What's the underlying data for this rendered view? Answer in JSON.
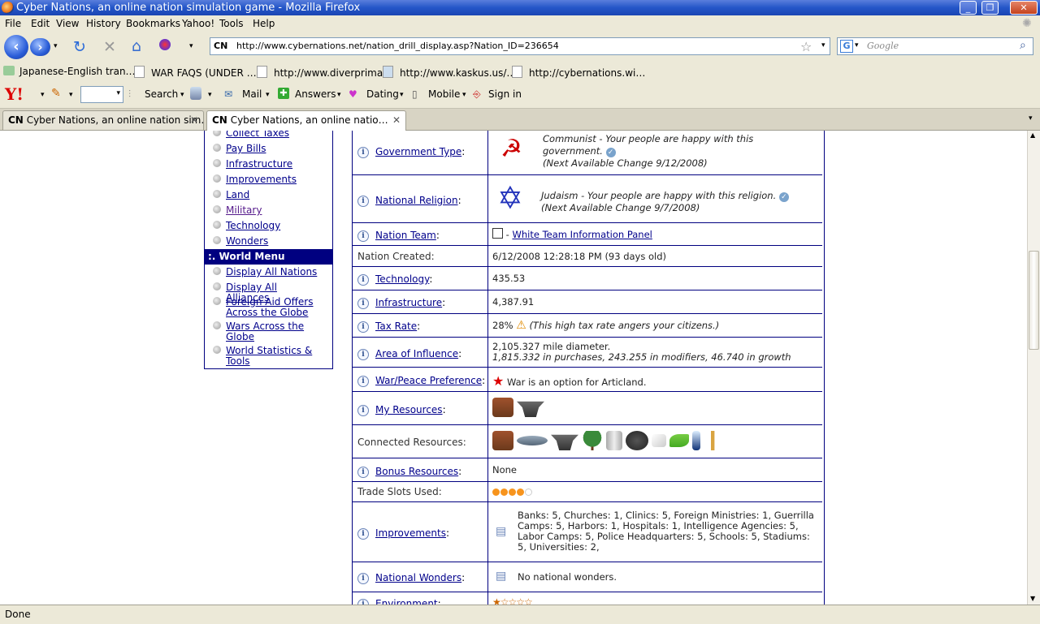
{
  "window": {
    "title": "Cyber Nations, an online nation simulation game - Mozilla Firefox"
  },
  "menu": [
    "File",
    "Edit",
    "View",
    "History",
    "Bookmarks",
    "Yahoo!",
    "Tools",
    "Help"
  ],
  "nav": {
    "site_badge": "CN",
    "url": "http://www.cybernations.net/nation_drill_display.asp?Nation_ID=236654",
    "search_placeholder": "Google"
  },
  "bookmarks": [
    "Japanese-English tran…",
    "WAR FAQS (UNDER …",
    "http://www.diverprima…",
    "http://www.kaskus.us/…",
    "http://cybernations.wi…"
  ],
  "yahoo_toolbar": {
    "logo": "Y!",
    "search": "Search",
    "mail": "Mail",
    "answers": "Answers",
    "dating": "Dating",
    "mobile": "Mobile",
    "signin": "Sign in"
  },
  "tabs": [
    {
      "badge": "CN",
      "label": "Cyber Nations, an online nation sim…"
    },
    {
      "badge": "CN",
      "label": "Cyber Nations, an online natio…"
    }
  ],
  "left_menu": {
    "nation_items": [
      "Collect Taxes",
      "Pay Bills",
      "Infrastructure",
      "Improvements",
      "Land",
      "Military",
      "Technology",
      "Wonders"
    ],
    "world_header": ":. World Menu",
    "world_items": [
      "Display All Nations",
      "Display All Alliances",
      "Foreign Aid Offers Across the Globe",
      "Wars Across the Globe",
      "World Statistics & Tools"
    ]
  },
  "stats": {
    "gov_label": "Government Type",
    "gov_line1": "Communist - Your people are happy with this",
    "gov_line2": "government.",
    "gov_line3": "(Next Available Change 9/12/2008)",
    "rel_label": "National Religion",
    "rel_line1": "Judaism - Your people are happy with this religion.",
    "rel_line2": "(Next Available Change 9/7/2008)",
    "team_label": "Nation Team",
    "team_link": "White Team Information Panel",
    "created_label": "Nation Created:",
    "created_value": "6/12/2008 12:28:18 PM (93 days old)",
    "tech_label": "Technology",
    "tech_value": "435.53",
    "infra_label": "Infrastructure",
    "infra_value": "4,387.91",
    "tax_label": "Tax Rate",
    "tax_value": "28%",
    "tax_note": "(This high tax rate angers your citizens.)",
    "area_label": "Area of Influence",
    "area_line1": "2,105.327 mile diameter.",
    "area_line2": "1,815.332 in purchases, 243.255 in modifiers, 46.740 in growth",
    "war_label": "War/Peace Preference",
    "war_value": "War is an option for Articland.",
    "myres_label": "My Resources",
    "conn_label": "Connected Resources:",
    "bonus_label": "Bonus Resources",
    "bonus_value": "None",
    "slots_label": "Trade Slots Used:",
    "slots_used": 4,
    "slots_total": 5,
    "impr_label": "Improvements",
    "impr_value": "Banks: 5, Churches: 1, Clinics: 5, Foreign Ministries: 1, Guerrilla Camps: 5, Harbors: 1, Hospitals: 1, Intelligence Agencies: 5, Labor Camps: 5, Police Headquarters: 5, Schools: 5, Stadiums: 5, Universities: 2,",
    "wond_label": "National Wonders",
    "wond_value": "No national wonders.",
    "env_label": "Environment"
  },
  "status": "Done",
  "colors": {
    "menu_header": "#000080",
    "link": "#00008b",
    "trade_dot": "#f7941d"
  }
}
